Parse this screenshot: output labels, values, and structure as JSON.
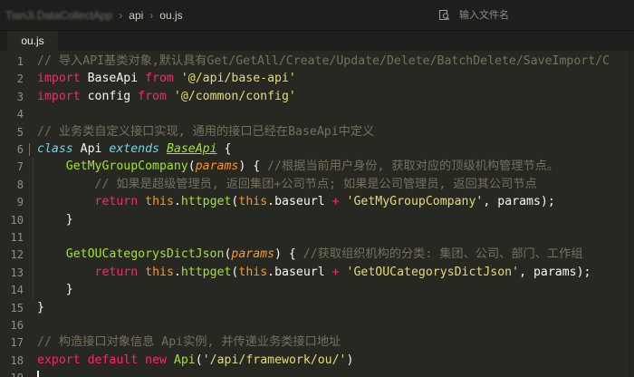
{
  "breadcrumb": {
    "root": "TianJi.DataCollectApp",
    "items": [
      "api",
      "ou.js"
    ]
  },
  "search": {
    "placeholder": "输入文件名",
    "icon": "search-file-icon"
  },
  "tab": {
    "label": "ou.js"
  },
  "editor": {
    "lines": [
      [
        {
          "t": "c",
          "v": "// 导入API基类对象,默认具有Get/GetAll/Create/Update/Delete/BatchDelete/SaveImport/C"
        }
      ],
      [
        {
          "t": "k",
          "v": "import"
        },
        {
          "t": "w",
          "v": " BaseApi "
        },
        {
          "t": "k",
          "v": "from"
        },
        {
          "t": "w",
          "v": " "
        },
        {
          "t": "s",
          "v": "'@/api/base-api'"
        }
      ],
      [
        {
          "t": "k",
          "v": "import"
        },
        {
          "t": "w",
          "v": " config "
        },
        {
          "t": "k",
          "v": "from"
        },
        {
          "t": "w",
          "v": " "
        },
        {
          "t": "s",
          "v": "'@/common/config'"
        }
      ],
      [],
      [
        {
          "t": "c",
          "v": "// 业务类自定义接口实现, 通用的接口已经在BaseApi中定义"
        }
      ],
      [
        {
          "t": "t",
          "v": "class"
        },
        {
          "t": "w",
          "v": " Api "
        },
        {
          "t": "t",
          "v": "extends"
        },
        {
          "t": "w",
          "v": " "
        },
        {
          "t": "inh",
          "v": "BaseApi"
        },
        {
          "t": "w",
          "v": " {"
        }
      ],
      [
        {
          "t": "w",
          "v": "    "
        },
        {
          "t": "f",
          "v": "GetMyGroupCompany"
        },
        {
          "t": "w",
          "v": "("
        },
        {
          "t": "p",
          "v": "params"
        },
        {
          "t": "w",
          "v": ") { "
        },
        {
          "t": "c",
          "v": "//根据当前用户身份, 获取对应的顶级机构管理节点。"
        }
      ],
      [
        {
          "t": "w",
          "v": "        "
        },
        {
          "t": "c",
          "v": "// 如果是超级管理员, 返回集团+公司节点; 如果是公司管理员, 返回其公司节点"
        }
      ],
      [
        {
          "t": "w",
          "v": "        "
        },
        {
          "t": "k",
          "v": "return"
        },
        {
          "t": "w",
          "v": " "
        },
        {
          "t": "th",
          "v": "this"
        },
        {
          "t": "w",
          "v": "."
        },
        {
          "t": "f",
          "v": "httpget"
        },
        {
          "t": "w",
          "v": "("
        },
        {
          "t": "th",
          "v": "this"
        },
        {
          "t": "w",
          "v": ".baseurl "
        },
        {
          "t": "k",
          "v": "+"
        },
        {
          "t": "w",
          "v": " "
        },
        {
          "t": "s",
          "v": "'GetMyGroupCompany'"
        },
        {
          "t": "w",
          "v": ", params);"
        }
      ],
      [
        {
          "t": "w",
          "v": "    }"
        }
      ],
      [],
      [
        {
          "t": "w",
          "v": "    "
        },
        {
          "t": "f",
          "v": "GetOUCategorysDictJson"
        },
        {
          "t": "w",
          "v": "("
        },
        {
          "t": "p",
          "v": "params"
        },
        {
          "t": "w",
          "v": ") { "
        },
        {
          "t": "c",
          "v": "//获取组织机构的分类: 集团、公司、部门、工作组"
        }
      ],
      [
        {
          "t": "w",
          "v": "        "
        },
        {
          "t": "k",
          "v": "return"
        },
        {
          "t": "w",
          "v": " "
        },
        {
          "t": "th",
          "v": "this"
        },
        {
          "t": "w",
          "v": "."
        },
        {
          "t": "f",
          "v": "httpget"
        },
        {
          "t": "w",
          "v": "("
        },
        {
          "t": "th",
          "v": "this"
        },
        {
          "t": "w",
          "v": ".baseurl "
        },
        {
          "t": "k",
          "v": "+"
        },
        {
          "t": "w",
          "v": " "
        },
        {
          "t": "s",
          "v": "'GetOUCategorysDictJson'"
        },
        {
          "t": "w",
          "v": ", params);"
        }
      ],
      [
        {
          "t": "w",
          "v": "    }"
        }
      ],
      [
        {
          "t": "w",
          "v": "}"
        }
      ],
      [],
      [
        {
          "t": "c",
          "v": "// 构造接口对象信息 Api实例, 并传递业务类接口地址"
        }
      ],
      [
        {
          "t": "k",
          "v": "export"
        },
        {
          "t": "w",
          "v": " "
        },
        {
          "t": "k",
          "v": "default"
        },
        {
          "t": "w",
          "v": " "
        },
        {
          "t": "k",
          "v": "new"
        },
        {
          "t": "w",
          "v": " "
        },
        {
          "t": "f",
          "v": "Api"
        },
        {
          "t": "w",
          "v": "("
        },
        {
          "t": "s",
          "v": "'/api/framework/ou/'"
        },
        {
          "t": "w",
          "v": ")"
        }
      ],
      []
    ],
    "fold_lines": [
      6
    ]
  },
  "colors": {
    "background": "#272822",
    "comment": "#75715e",
    "keyword": "#f92672",
    "string": "#e6db74",
    "function": "#a6e22e",
    "storage": "#66d9ef",
    "parameter": "#fd971f"
  }
}
